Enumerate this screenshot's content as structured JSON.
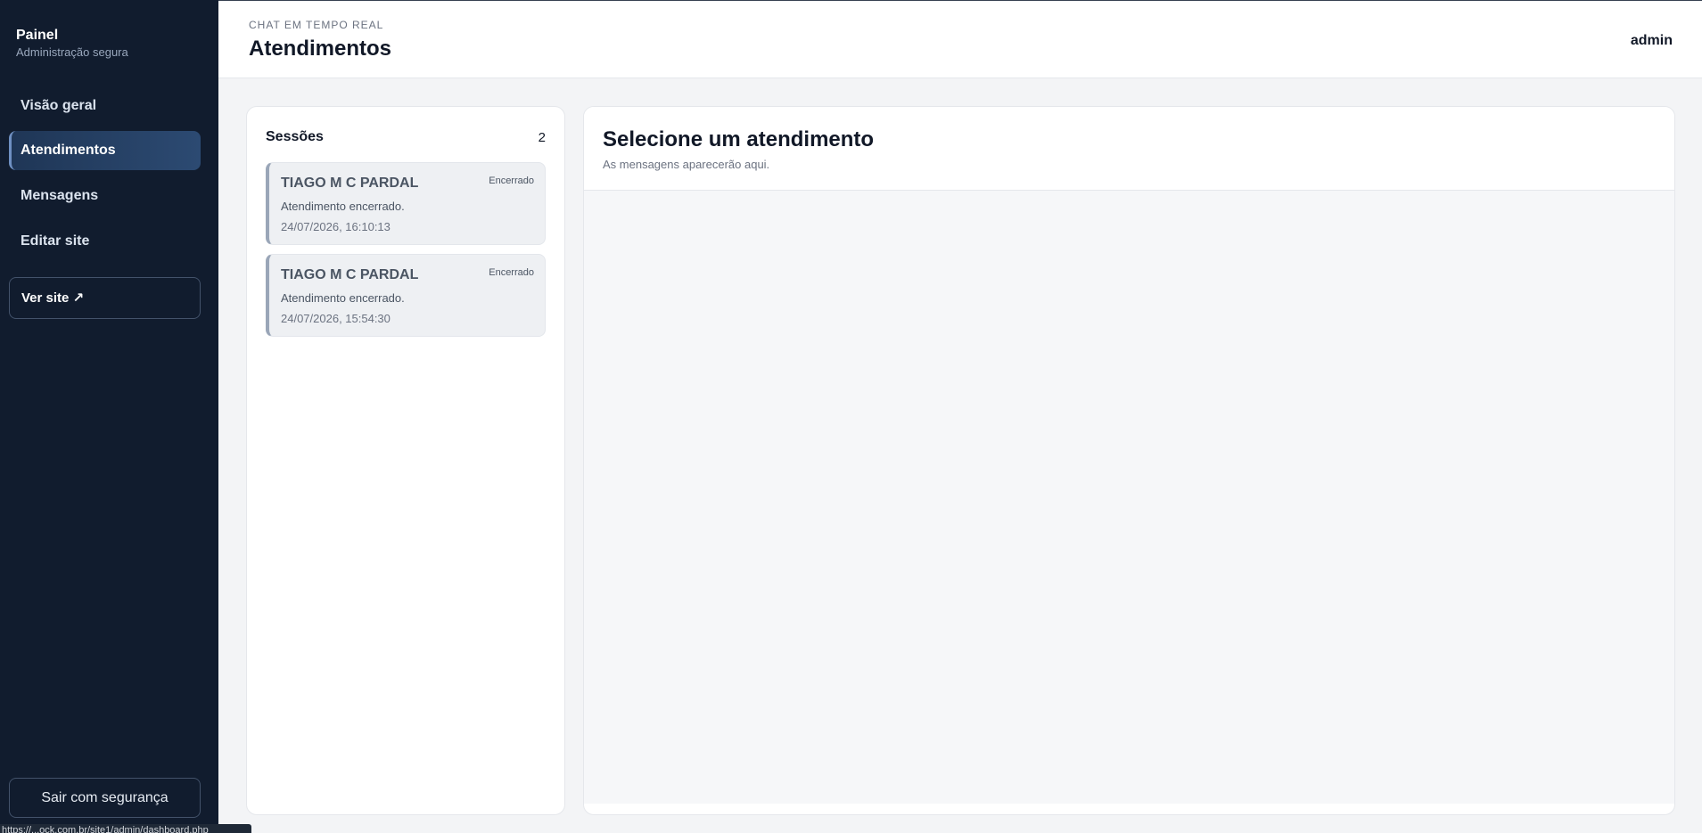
{
  "sidebar": {
    "brand_title": "Painel",
    "brand_subtitle": "Administração segura",
    "items": [
      {
        "label": "Visão geral"
      },
      {
        "label": "Atendimentos",
        "active": true
      },
      {
        "label": "Mensagens"
      },
      {
        "label": "Editar site"
      }
    ],
    "view_site": "Ver site ↗",
    "logout": "Sair com segurança"
  },
  "header": {
    "kicker": "CHAT EM TEMPO REAL",
    "title": "Atendimentos",
    "user": "admin"
  },
  "sessions": {
    "title": "Sessões",
    "count": "2",
    "items": [
      {
        "name": "TIAGO M C PARDAL",
        "status": "Encerrado",
        "preview": "Atendimento encerrado.",
        "time": "24/07/2026, 16:10:13"
      },
      {
        "name": "TIAGO M C PARDAL",
        "status": "Encerrado",
        "preview": "Atendimento encerrado.",
        "time": "24/07/2026, 15:54:30"
      }
    ]
  },
  "chat": {
    "title": "Selecione um atendimento",
    "subtitle": "As mensagens aparecerão aqui."
  },
  "status_bar_url": "https://...ock.com.br/site1/admin/dashboard.php",
  "colors": {
    "sidebar_bg": "#111c2e",
    "active_nav": "#2c4a72",
    "page_bg": "#f3f4f6"
  }
}
